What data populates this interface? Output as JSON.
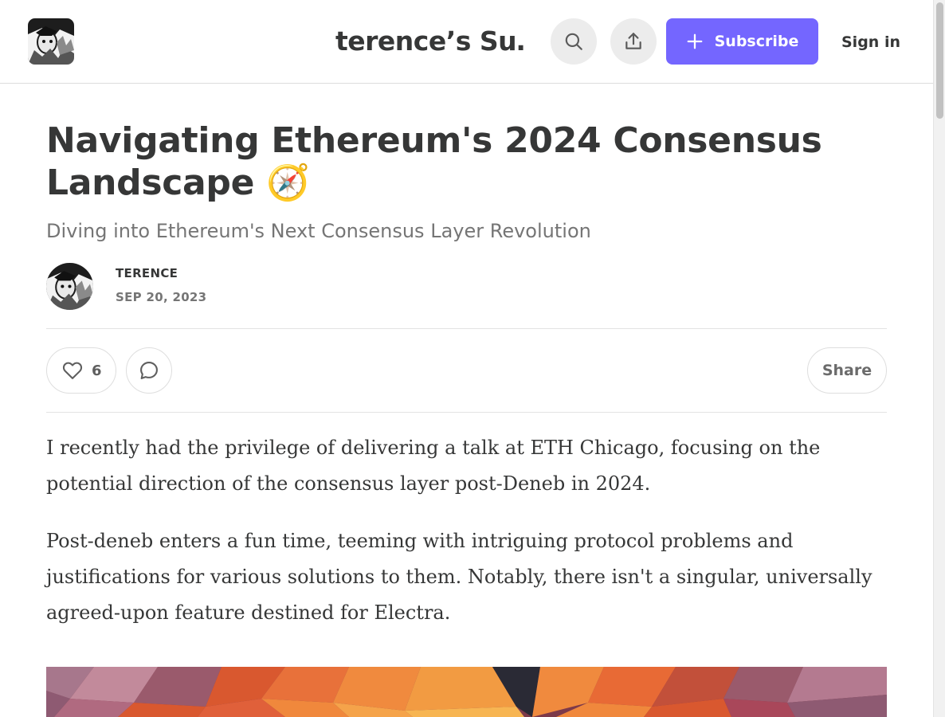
{
  "header": {
    "publication_title": "terence’s Su…",
    "subscribe_label": "Subscribe",
    "sign_in_label": "Sign in",
    "icons": {
      "logo": "publication-logo",
      "search": "search-icon",
      "share": "share-upload-icon",
      "plus": "plus-icon"
    }
  },
  "post": {
    "title": "Navigating Ethereum's 2024 Consensus Landscape 🧭",
    "subtitle": "Diving into Ethereum's Next Consensus Layer Revolution",
    "author": "TERENCE",
    "date": "SEP 20, 2023",
    "like_count": "6",
    "share_label": "Share",
    "paragraphs": [
      "I recently had the privilege of delivering a talk at ETH Chicago, focusing on the potential direction of the consensus layer post-Deneb in 2024.",
      "Post-deneb enters a fun time, teeming with intriguing protocol problems and justifications for various solutions to them. Notably, there isn't a singular, universally agreed-upon feature destined for Electra."
    ]
  },
  "colors": {
    "accent": "#7466ff",
    "text": "#363737",
    "muted": "#757575"
  }
}
